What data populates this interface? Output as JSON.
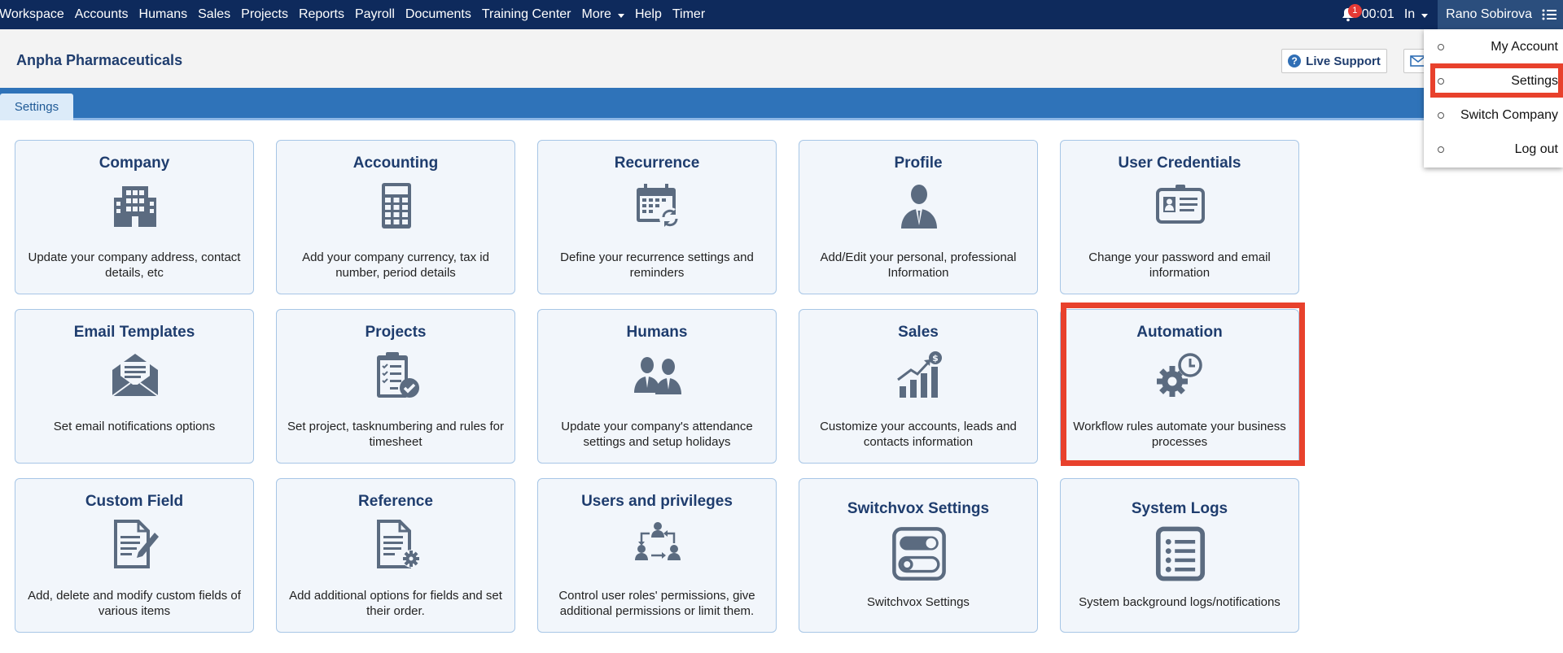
{
  "nav": {
    "items": [
      "Workspace",
      "Accounts",
      "Humans",
      "Sales",
      "Projects",
      "Reports",
      "Payroll",
      "Documents",
      "Training Center",
      "More",
      "Help",
      "Timer"
    ],
    "notification_count": "1",
    "timer": "00:01",
    "status": "In",
    "user_name": "Rano Sobirova"
  },
  "header": {
    "company_name": "Anpha Pharmaceuticals",
    "live_support": "Live Support"
  },
  "tabs": {
    "settings": "Settings"
  },
  "dropdown": {
    "items": [
      "My Account",
      "Settings",
      "Switch Company",
      "Log out"
    ]
  },
  "cards": [
    {
      "title": "Company",
      "desc": "Update your company address, contact details, etc",
      "icon": "building-icon"
    },
    {
      "title": "Accounting",
      "desc": "Add your company currency, tax id number, period details",
      "icon": "calculator-icon"
    },
    {
      "title": "Recurrence",
      "desc": "Define your recurrence settings and reminders",
      "icon": "calendar-refresh-icon"
    },
    {
      "title": "Profile",
      "desc": "Add/Edit your personal, professional Information",
      "icon": "person-icon"
    },
    {
      "title": "User Credentials",
      "desc": "Change your password and email information",
      "icon": "id-card-icon"
    },
    {
      "title": "Email Templates",
      "desc": "Set email notifications options",
      "icon": "envelope-icon"
    },
    {
      "title": "Projects",
      "desc": "Set project, tasknumbering and rules for timesheet",
      "icon": "clipboard-check-icon"
    },
    {
      "title": "Humans",
      "desc": "Update your company's attendance settings and setup holidays",
      "icon": "people-icon"
    },
    {
      "title": "Sales",
      "desc": "Customize your accounts, leads and contacts information",
      "icon": "growth-chart-icon"
    },
    {
      "title": "Automation",
      "desc": "Workflow rules automate your business processes",
      "icon": "gear-clock-icon"
    },
    {
      "title": "Custom Field",
      "desc": "Add, delete and modify custom fields of various items",
      "icon": "document-pen-icon"
    },
    {
      "title": "Reference",
      "desc": "Add additional options for fields and set their order.",
      "icon": "document-gear-icon"
    },
    {
      "title": "Users and privileges",
      "desc": "Control user roles' permissions, give additional permissions or limit them.",
      "icon": "user-transfer-icon"
    },
    {
      "title": "Switchvox Settings",
      "desc": "Switchvox Settings",
      "icon": "toggle-icon"
    },
    {
      "title": "System Logs",
      "desc": "System background logs/notifications",
      "icon": "list-icon"
    }
  ],
  "colors": {
    "nav_bg": "#0e2a5c",
    "tabbar_bg": "#2f73b9",
    "title_blue": "#1f3d6e",
    "icon_gray": "#5b6b80",
    "highlight_red": "#e8412c"
  }
}
